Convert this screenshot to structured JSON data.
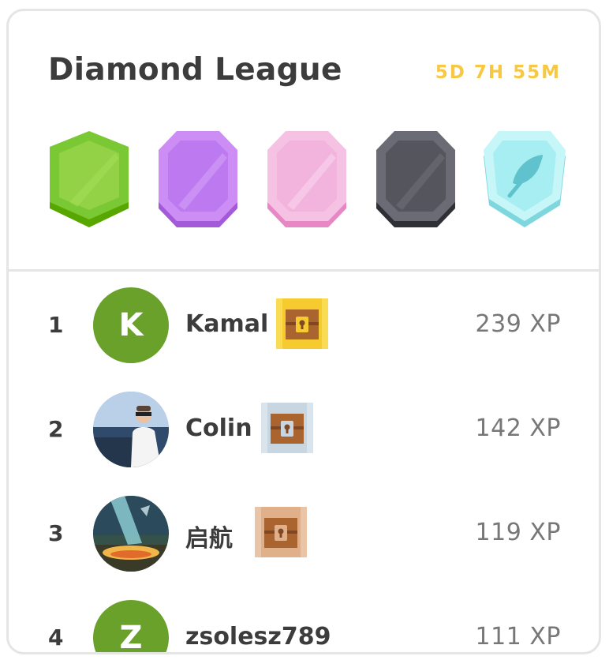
{
  "league": {
    "title": "Diamond League",
    "timer": "5D 7H 55M"
  },
  "badges": [
    {
      "name": "green-league-badge",
      "color": "#7ac833"
    },
    {
      "name": "purple-league-badge",
      "color": "#bd7af0"
    },
    {
      "name": "pink-league-badge",
      "color": "#f2a7d7"
    },
    {
      "name": "dark-league-badge",
      "color": "#4b4b55"
    },
    {
      "name": "diamond-league-badge",
      "color": "#a6eef2",
      "icon": "feather-icon"
    }
  ],
  "leaderboard": [
    {
      "rank": "1",
      "name": "Kamal",
      "xp": "239 XP",
      "avatar_letter": "K",
      "avatar_color": "#69a12b",
      "chest": "gold-chest-icon"
    },
    {
      "rank": "2",
      "name": "Colin",
      "xp": "142 XP",
      "avatar_letter": "",
      "avatar_color": "#4a6f99",
      "chest": "silver-chest-icon"
    },
    {
      "rank": "3",
      "name": "启航",
      "xp": "119 XP",
      "avatar_letter": "",
      "avatar_color": "#2d4a3a",
      "chest": "bronze-chest-icon"
    },
    {
      "rank": "4",
      "name": "zsolesz789",
      "xp": "111 XP",
      "avatar_letter": "Z",
      "avatar_color": "#69a12b",
      "chest": ""
    }
  ]
}
